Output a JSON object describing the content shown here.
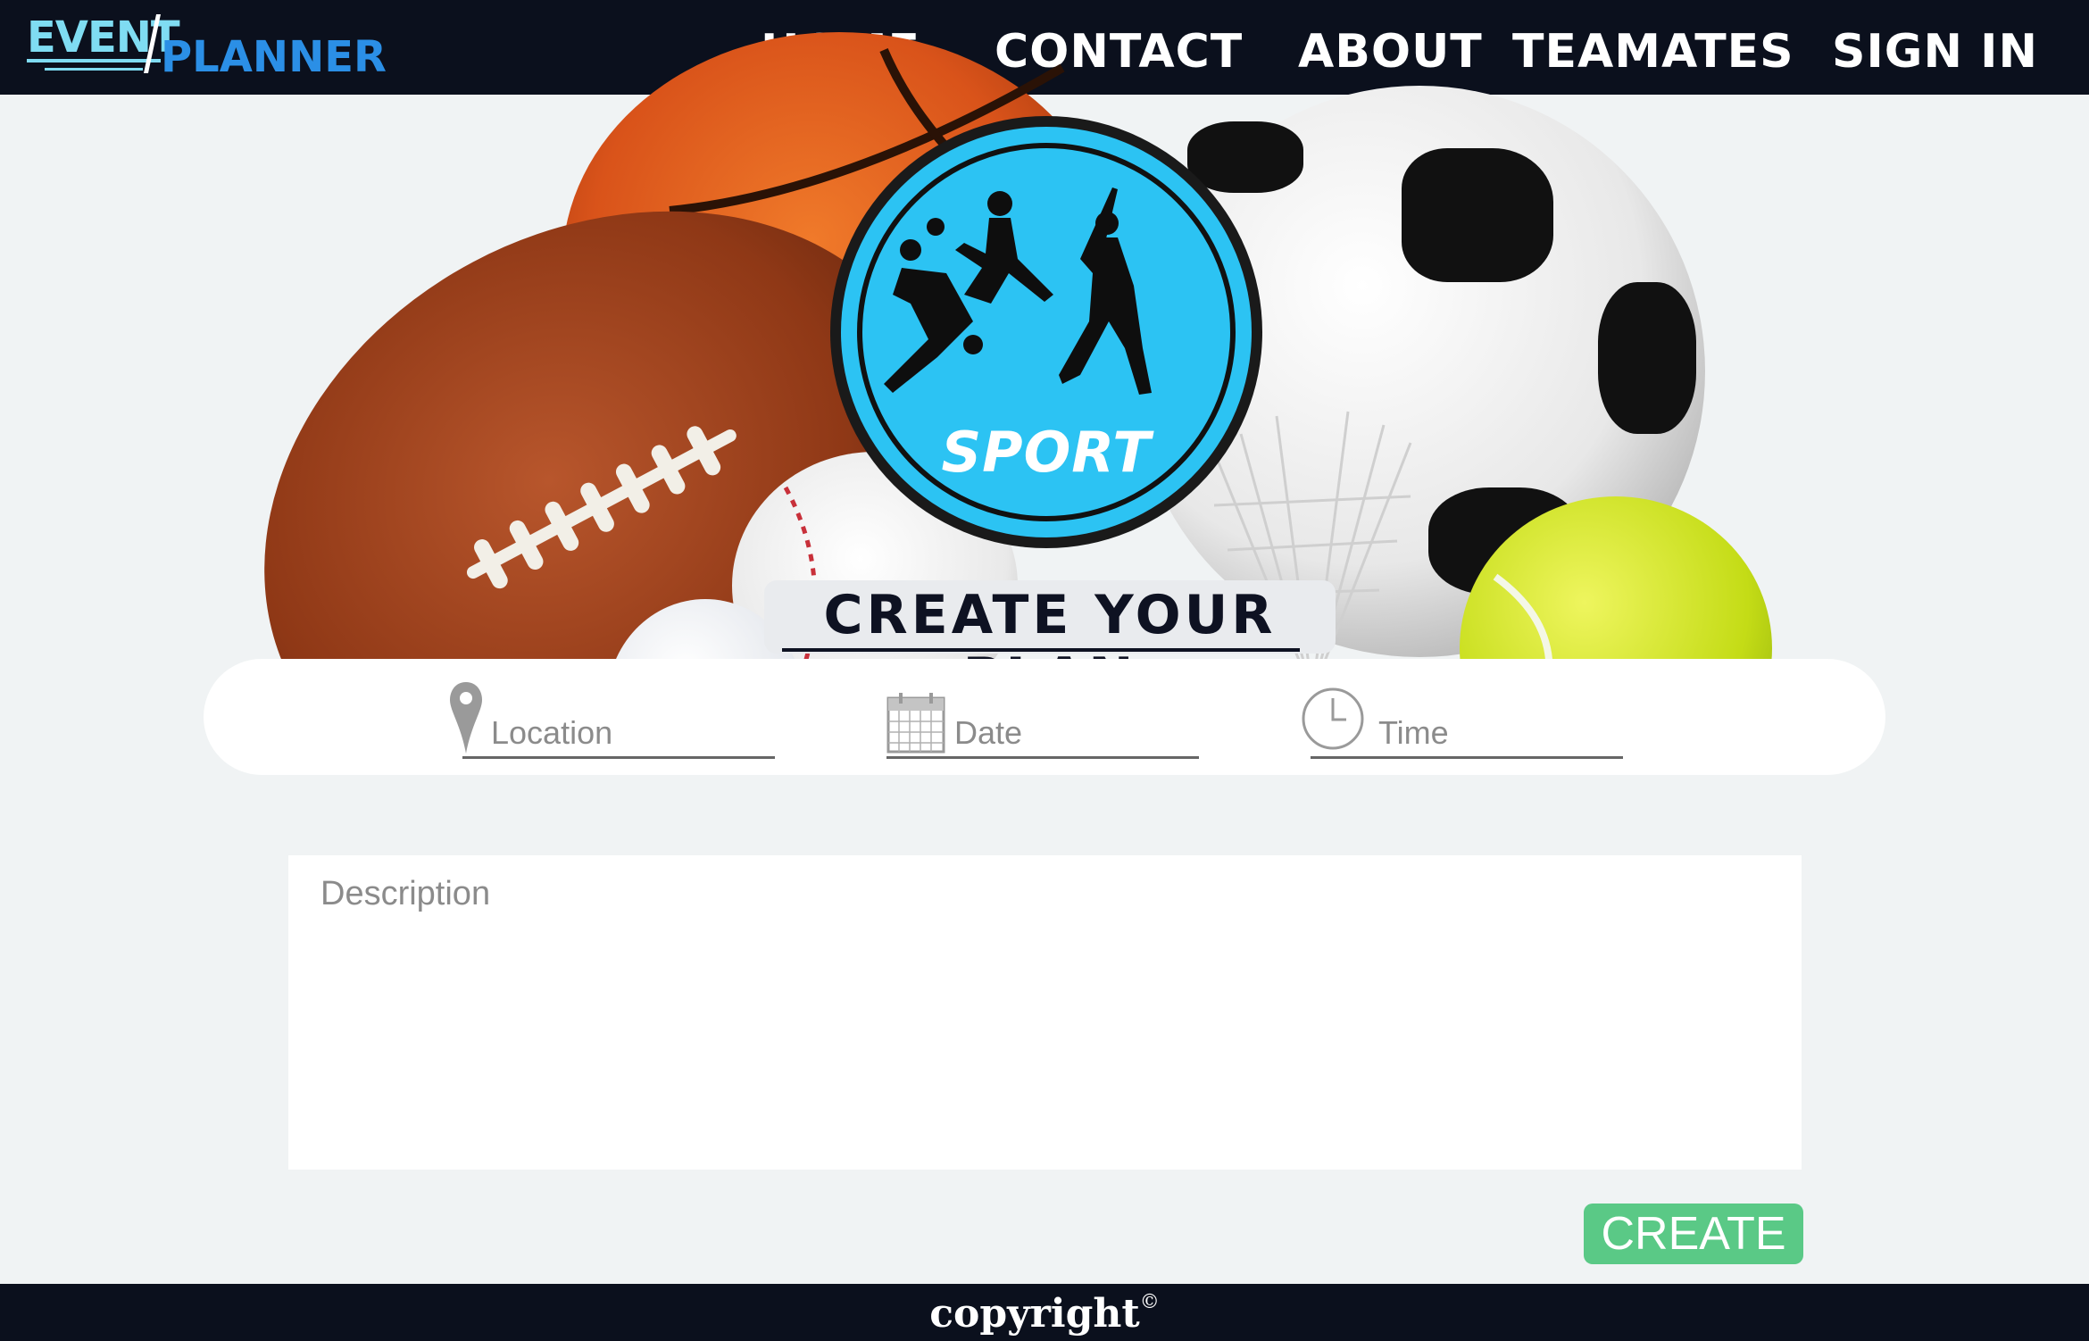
{
  "brand": {
    "word1": "EVENT",
    "word2": "PLANNER"
  },
  "nav": {
    "home": "HOME",
    "contact": "CONTACT",
    "about": "ABOUT",
    "teamates": "TEAMATES",
    "signin": "SIGN IN"
  },
  "hero": {
    "emblem_text": "SPORT",
    "title": "CREATE YOUR PLAN"
  },
  "form": {
    "location_placeholder": "Location",
    "date_placeholder": "Date",
    "time_placeholder": "Time",
    "description_placeholder": "Description",
    "create_label": "CREATE"
  },
  "footer": {
    "copyright": "copyright",
    "symbol": "©"
  },
  "colors": {
    "navbar": "#0b101d",
    "brand_event": "#7fdcf2",
    "brand_planner": "#2b8fe6",
    "emblem": "#2cc3f3",
    "create_button": "#5ac986",
    "page_bg": "#f0f3f4"
  },
  "icons": {
    "location": "map-pin-icon",
    "date": "calendar-icon",
    "time": "clock-icon"
  }
}
